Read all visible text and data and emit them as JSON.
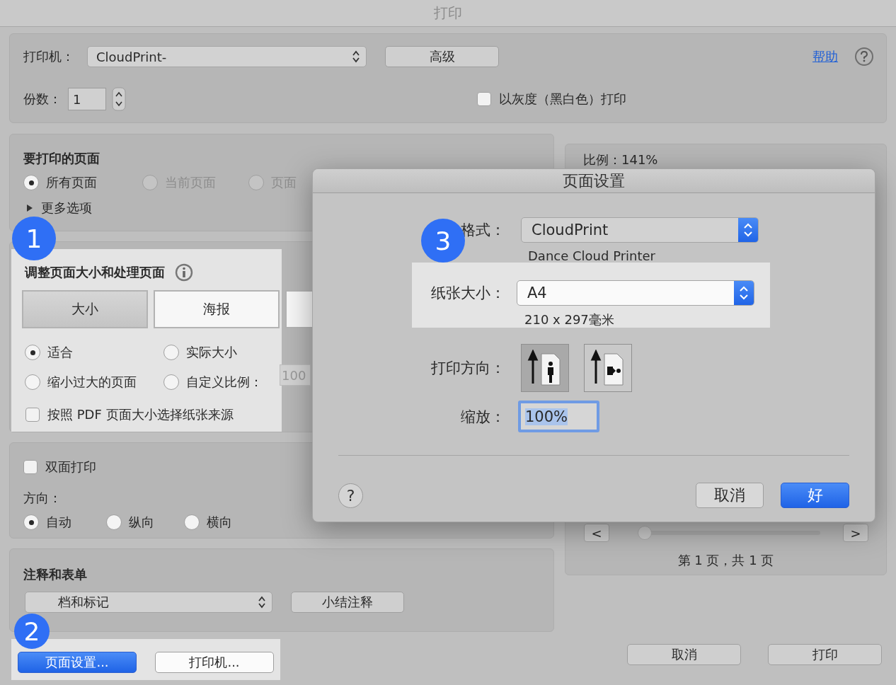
{
  "window": {
    "title": "打印"
  },
  "printer": {
    "label": "打印机：",
    "value": "CloudPrint-",
    "advanced_button": "高级",
    "help_link": "帮助"
  },
  "copies": {
    "label": "份数：",
    "value": "1"
  },
  "grayscale": {
    "label": "以灰度（黑白色）打印",
    "checked": false
  },
  "pages": {
    "title": "要打印的页面",
    "options": [
      {
        "label": "所有页面",
        "selected": true,
        "disabled": false
      },
      {
        "label": "当前页面",
        "selected": false,
        "disabled": true
      },
      {
        "label": "页面",
        "selected": false,
        "disabled": true
      }
    ],
    "more": "更多选项",
    "expanded": false
  },
  "resize": {
    "title": "调整页面大小和处理页面",
    "tabs": [
      {
        "label": "大小",
        "selected": true
      },
      {
        "label": "海报",
        "selected": false
      },
      {
        "selected": false
      }
    ],
    "options": [
      {
        "label": "适合",
        "selected": true
      },
      {
        "label": "实际大小",
        "selected": false
      },
      {
        "label": "缩小过大的页面",
        "selected": false
      },
      {
        "label": "自定义比例：",
        "selected": false
      }
    ],
    "custom_scale": "100",
    "pdf_source": {
      "label": "按照 PDF 页面大小选择纸张来源",
      "checked": false
    }
  },
  "duplex": {
    "label": "双面打印",
    "checked": false
  },
  "orientation": {
    "label": "方向：",
    "options": [
      {
        "label": "自动",
        "selected": true
      },
      {
        "label": "纵向",
        "selected": false
      },
      {
        "label": "横向",
        "selected": false
      }
    ]
  },
  "annotations": {
    "title": "注释和表单",
    "value": "档和标记",
    "summary_button": "小结注释"
  },
  "footer": {
    "page_setup_button": "页面设置...",
    "printer_button": "打印机...",
    "cancel_button": "取消",
    "print_button": "打印"
  },
  "preview": {
    "scale": "比例：141%",
    "prev": "<",
    "next": ">",
    "level": 0,
    "page_info": "第 1 页，共 1 页"
  },
  "page_setup_dialog": {
    "title": "页面设置",
    "format_label": "格式：",
    "format_value": "CloudPrint",
    "format_desc": "Dance Cloud Printer",
    "paper_label": "纸张大小：",
    "paper_value": "A4",
    "paper_desc": "210 x 297毫米",
    "orientation_label": "打印方向：",
    "orientations": [
      {
        "kind": "portrait",
        "selected": true
      },
      {
        "kind": "landscape",
        "selected": false
      }
    ],
    "scale_label": "缩放：",
    "scale_value": "100%",
    "help_button": "?",
    "cancel_button": "取消",
    "ok_button": "好"
  },
  "callouts": [
    "1",
    "2",
    "3"
  ]
}
